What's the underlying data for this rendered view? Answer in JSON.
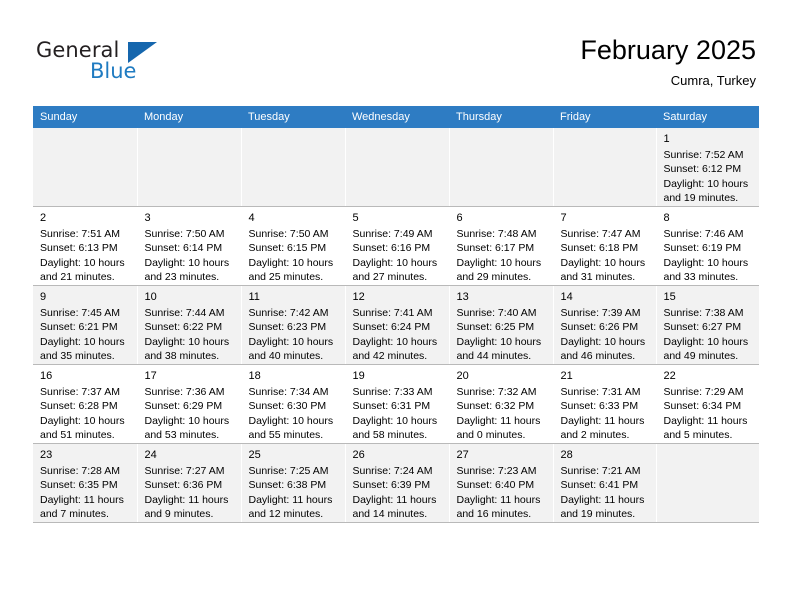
{
  "logo": {
    "word1": "General",
    "word2": "Blue",
    "triangle_color": "#1566ad",
    "blue_color": "#1f7bc1"
  },
  "header": {
    "title": "February 2025",
    "subtitle": "Cumra, Turkey",
    "header_bg": "#2e7cc3"
  },
  "weekdays": [
    "Sunday",
    "Monday",
    "Tuesday",
    "Wednesday",
    "Thursday",
    "Friday",
    "Saturday"
  ],
  "labels": {
    "sunrise": "Sunrise:",
    "sunset": "Sunset:",
    "daylight": "Daylight:"
  },
  "weeks": [
    [
      {
        "day": "",
        "sunrise": "",
        "sunset": "",
        "daylight_1": "",
        "daylight_2": ""
      },
      {
        "day": "",
        "sunrise": "",
        "sunset": "",
        "daylight_1": "",
        "daylight_2": ""
      },
      {
        "day": "",
        "sunrise": "",
        "sunset": "",
        "daylight_1": "",
        "daylight_2": ""
      },
      {
        "day": "",
        "sunrise": "",
        "sunset": "",
        "daylight_1": "",
        "daylight_2": ""
      },
      {
        "day": "",
        "sunrise": "",
        "sunset": "",
        "daylight_1": "",
        "daylight_2": ""
      },
      {
        "day": "",
        "sunrise": "",
        "sunset": "",
        "daylight_1": "",
        "daylight_2": ""
      },
      {
        "day": "1",
        "sunrise": "Sunrise: 7:52 AM",
        "sunset": "Sunset: 6:12 PM",
        "daylight_1": "Daylight: 10 hours",
        "daylight_2": "and 19 minutes."
      }
    ],
    [
      {
        "day": "2",
        "sunrise": "Sunrise: 7:51 AM",
        "sunset": "Sunset: 6:13 PM",
        "daylight_1": "Daylight: 10 hours",
        "daylight_2": "and 21 minutes."
      },
      {
        "day": "3",
        "sunrise": "Sunrise: 7:50 AM",
        "sunset": "Sunset: 6:14 PM",
        "daylight_1": "Daylight: 10 hours",
        "daylight_2": "and 23 minutes."
      },
      {
        "day": "4",
        "sunrise": "Sunrise: 7:50 AM",
        "sunset": "Sunset: 6:15 PM",
        "daylight_1": "Daylight: 10 hours",
        "daylight_2": "and 25 minutes."
      },
      {
        "day": "5",
        "sunrise": "Sunrise: 7:49 AM",
        "sunset": "Sunset: 6:16 PM",
        "daylight_1": "Daylight: 10 hours",
        "daylight_2": "and 27 minutes."
      },
      {
        "day": "6",
        "sunrise": "Sunrise: 7:48 AM",
        "sunset": "Sunset: 6:17 PM",
        "daylight_1": "Daylight: 10 hours",
        "daylight_2": "and 29 minutes."
      },
      {
        "day": "7",
        "sunrise": "Sunrise: 7:47 AM",
        "sunset": "Sunset: 6:18 PM",
        "daylight_1": "Daylight: 10 hours",
        "daylight_2": "and 31 minutes."
      },
      {
        "day": "8",
        "sunrise": "Sunrise: 7:46 AM",
        "sunset": "Sunset: 6:19 PM",
        "daylight_1": "Daylight: 10 hours",
        "daylight_2": "and 33 minutes."
      }
    ],
    [
      {
        "day": "9",
        "sunrise": "Sunrise: 7:45 AM",
        "sunset": "Sunset: 6:21 PM",
        "daylight_1": "Daylight: 10 hours",
        "daylight_2": "and 35 minutes."
      },
      {
        "day": "10",
        "sunrise": "Sunrise: 7:44 AM",
        "sunset": "Sunset: 6:22 PM",
        "daylight_1": "Daylight: 10 hours",
        "daylight_2": "and 38 minutes."
      },
      {
        "day": "11",
        "sunrise": "Sunrise: 7:42 AM",
        "sunset": "Sunset: 6:23 PM",
        "daylight_1": "Daylight: 10 hours",
        "daylight_2": "and 40 minutes."
      },
      {
        "day": "12",
        "sunrise": "Sunrise: 7:41 AM",
        "sunset": "Sunset: 6:24 PM",
        "daylight_1": "Daylight: 10 hours",
        "daylight_2": "and 42 minutes."
      },
      {
        "day": "13",
        "sunrise": "Sunrise: 7:40 AM",
        "sunset": "Sunset: 6:25 PM",
        "daylight_1": "Daylight: 10 hours",
        "daylight_2": "and 44 minutes."
      },
      {
        "day": "14",
        "sunrise": "Sunrise: 7:39 AM",
        "sunset": "Sunset: 6:26 PM",
        "daylight_1": "Daylight: 10 hours",
        "daylight_2": "and 46 minutes."
      },
      {
        "day": "15",
        "sunrise": "Sunrise: 7:38 AM",
        "sunset": "Sunset: 6:27 PM",
        "daylight_1": "Daylight: 10 hours",
        "daylight_2": "and 49 minutes."
      }
    ],
    [
      {
        "day": "16",
        "sunrise": "Sunrise: 7:37 AM",
        "sunset": "Sunset: 6:28 PM",
        "daylight_1": "Daylight: 10 hours",
        "daylight_2": "and 51 minutes."
      },
      {
        "day": "17",
        "sunrise": "Sunrise: 7:36 AM",
        "sunset": "Sunset: 6:29 PM",
        "daylight_1": "Daylight: 10 hours",
        "daylight_2": "and 53 minutes."
      },
      {
        "day": "18",
        "sunrise": "Sunrise: 7:34 AM",
        "sunset": "Sunset: 6:30 PM",
        "daylight_1": "Daylight: 10 hours",
        "daylight_2": "and 55 minutes."
      },
      {
        "day": "19",
        "sunrise": "Sunrise: 7:33 AM",
        "sunset": "Sunset: 6:31 PM",
        "daylight_1": "Daylight: 10 hours",
        "daylight_2": "and 58 minutes."
      },
      {
        "day": "20",
        "sunrise": "Sunrise: 7:32 AM",
        "sunset": "Sunset: 6:32 PM",
        "daylight_1": "Daylight: 11 hours",
        "daylight_2": "and 0 minutes."
      },
      {
        "day": "21",
        "sunrise": "Sunrise: 7:31 AM",
        "sunset": "Sunset: 6:33 PM",
        "daylight_1": "Daylight: 11 hours",
        "daylight_2": "and 2 minutes."
      },
      {
        "day": "22",
        "sunrise": "Sunrise: 7:29 AM",
        "sunset": "Sunset: 6:34 PM",
        "daylight_1": "Daylight: 11 hours",
        "daylight_2": "and 5 minutes."
      }
    ],
    [
      {
        "day": "23",
        "sunrise": "Sunrise: 7:28 AM",
        "sunset": "Sunset: 6:35 PM",
        "daylight_1": "Daylight: 11 hours",
        "daylight_2": "and 7 minutes."
      },
      {
        "day": "24",
        "sunrise": "Sunrise: 7:27 AM",
        "sunset": "Sunset: 6:36 PM",
        "daylight_1": "Daylight: 11 hours",
        "daylight_2": "and 9 minutes."
      },
      {
        "day": "25",
        "sunrise": "Sunrise: 7:25 AM",
        "sunset": "Sunset: 6:38 PM",
        "daylight_1": "Daylight: 11 hours",
        "daylight_2": "and 12 minutes."
      },
      {
        "day": "26",
        "sunrise": "Sunrise: 7:24 AM",
        "sunset": "Sunset: 6:39 PM",
        "daylight_1": "Daylight: 11 hours",
        "daylight_2": "and 14 minutes."
      },
      {
        "day": "27",
        "sunrise": "Sunrise: 7:23 AM",
        "sunset": "Sunset: 6:40 PM",
        "daylight_1": "Daylight: 11 hours",
        "daylight_2": "and 16 minutes."
      },
      {
        "day": "28",
        "sunrise": "Sunrise: 7:21 AM",
        "sunset": "Sunset: 6:41 PM",
        "daylight_1": "Daylight: 11 hours",
        "daylight_2": "and 19 minutes."
      },
      {
        "day": "",
        "sunrise": "",
        "sunset": "",
        "daylight_1": "",
        "daylight_2": ""
      }
    ]
  ]
}
